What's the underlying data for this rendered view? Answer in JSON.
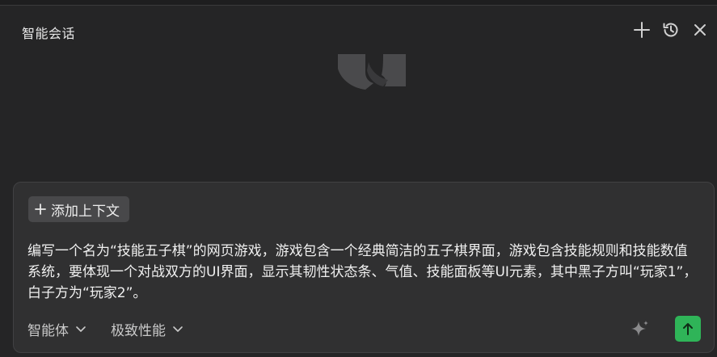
{
  "header": {
    "title": "智能会话",
    "actions": [
      "plus-icon",
      "history-icon",
      "close-icon"
    ]
  },
  "composer": {
    "add_context_label": "添加上下文",
    "prompt_text": "编写一个名为“技能五子棋”的网页游戏，游戏包含一个经典简洁的五子棋界面，游戏包含技能规则和技能数值系统，要体现一个对战双方的UI界面，显示其韧性状态条、气值、技能面板等UI元素，其中黑子方叫“玩家1”，白子方为“玩家2”。",
    "agent_selector": "智能体",
    "mode_selector": "极致性能"
  },
  "colors": {
    "background": "#252526",
    "composer_bg": "#303031",
    "send_button": "#2fb458",
    "chip_bg": "#48484a"
  }
}
